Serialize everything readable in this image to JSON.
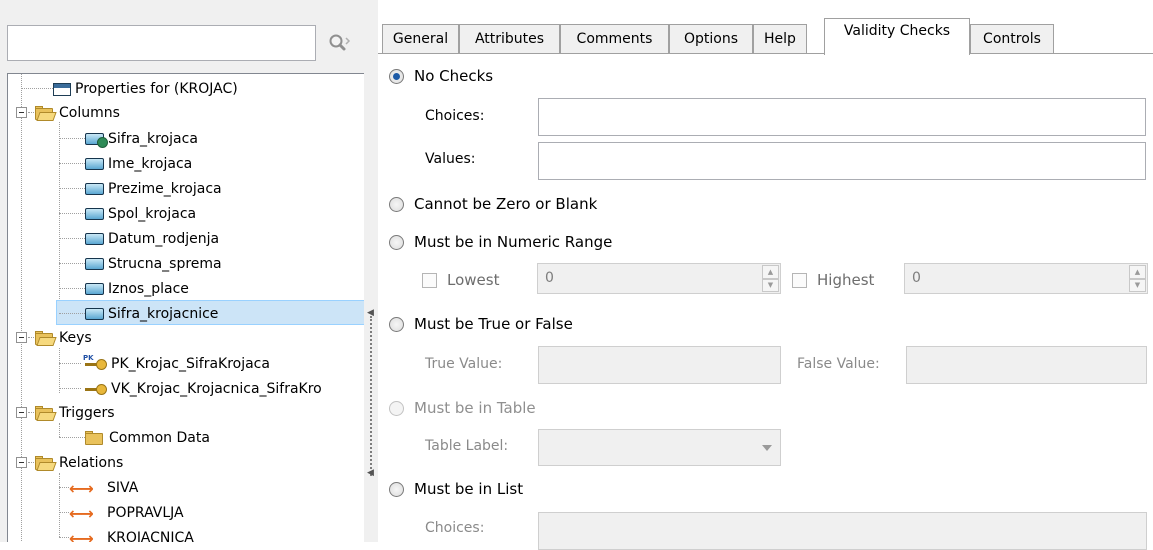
{
  "search": {
    "value": "",
    "placeholder": ""
  },
  "tree": {
    "properties_label": "Properties for (KROJAC)",
    "columns_label": "Columns",
    "columns": [
      "Sifra_krojaca",
      "Ime_krojaca",
      "Prezime_krojaca",
      "Spol_krojaca",
      "Datum_rodjenja",
      "Strucna_sprema",
      "Iznos_place",
      "Sifra_krojacnice"
    ],
    "selected_column": "Sifra_krojacnice",
    "keys_label": "Keys",
    "keys": [
      "PK_Krojac_SifraKrojaca",
      "VK_Krojac_Krojacnica_SifraKro"
    ],
    "pk_tag": "PK",
    "triggers_label": "Triggers",
    "triggers": [
      "Common Data"
    ],
    "relations_label": "Relations",
    "relations": [
      "SIVA",
      "POPRAVLJA",
      "KROJACNICA"
    ],
    "relation_glyph": "←→"
  },
  "tabs": [
    "General",
    "Attributes",
    "Comments",
    "Options",
    "Help",
    "Validity Checks",
    "Controls"
  ],
  "active_tab": "Validity Checks",
  "validity": {
    "no_checks": "No Checks",
    "choices_label": "Choices:",
    "choices_value": "",
    "values_label": "Values:",
    "values_value": "",
    "cannot_zero": "Cannot be Zero or Blank",
    "numeric_range": "Must be in Numeric Range",
    "lowest_label": "Lowest",
    "lowest_value": "0",
    "highest_label": "Highest",
    "highest_value": "0",
    "true_false": "Must be True or False",
    "true_value_label": "True Value:",
    "false_value_label": "False Value:",
    "in_table": "Must be in Table",
    "table_label": "Table Label:",
    "in_list": "Must be in List",
    "list_choices_label": "Choices:"
  },
  "selected_option": "No Checks",
  "colors": {
    "selection_bg": "#cce4f7",
    "selection_border": "#99d1ff",
    "relation_arrow": "#e56a1f",
    "radio_dot": "#1c5aa6"
  }
}
